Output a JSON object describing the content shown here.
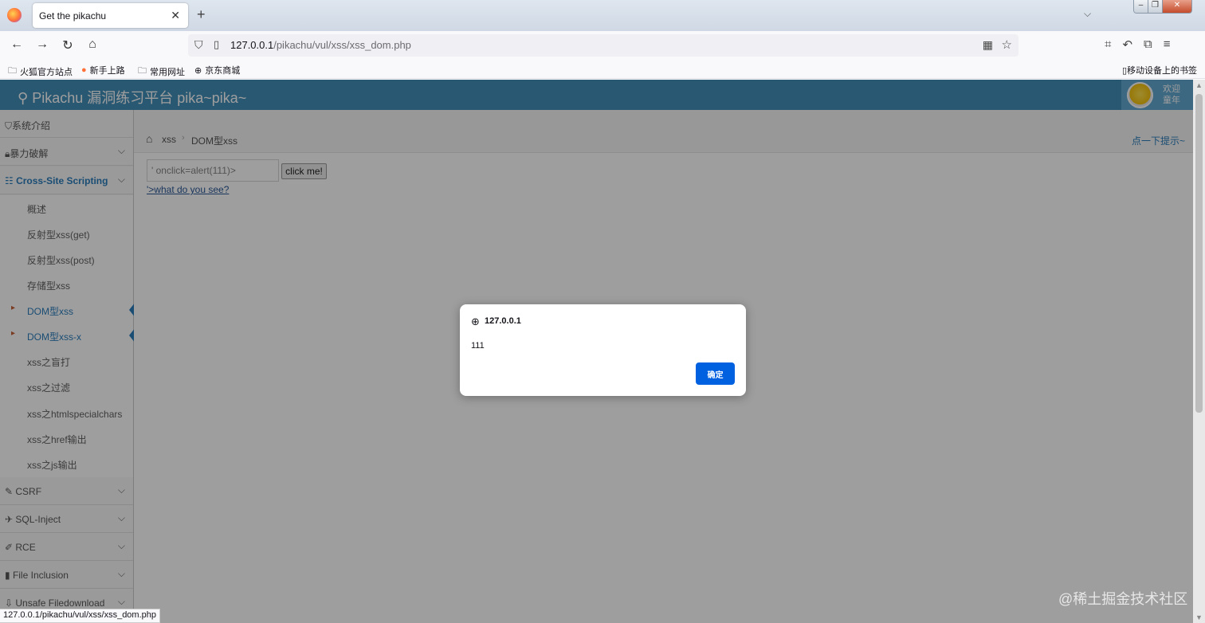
{
  "browser": {
    "tab_title": "Get the pikachu",
    "tab_close": "✕",
    "new_tab": "+",
    "tab_list": "⌵",
    "url_host": "127.0.0.1",
    "url_path": "/pikachu/vul/xss/xss_dom.php",
    "bookmarks": [
      "火狐官方站点",
      "新手上路",
      "常用网址",
      "京东商城"
    ],
    "mobile_bookmarks": "移动设备上的书签"
  },
  "site": {
    "title": "Pikachu 漏洞练习平台 pika~pika~",
    "welcome": "欢迎 童年"
  },
  "sidebar": {
    "items": [
      {
        "label": "系统介绍",
        "icon": "tag-icon"
      },
      {
        "label": "暴力破解",
        "icon": "lock-icon"
      },
      {
        "label": "Cross-Site Scripting",
        "icon": "list-icon"
      }
    ],
    "xss_sub": [
      "概述",
      "反射型xss(get)",
      "反射型xss(post)",
      "存储型xss",
      "DOM型xss",
      "DOM型xss-x",
      "xss之盲打",
      "xss之过滤",
      "xss之htmlspecialchars",
      "xss之href输出",
      "xss之js输出"
    ],
    "bottom_items": [
      {
        "label": "CSRF"
      },
      {
        "label": "SQL-Inject"
      },
      {
        "label": "RCE"
      },
      {
        "label": "File Inclusion"
      },
      {
        "label": "Unsafe Filedownload"
      }
    ]
  },
  "breadcrumb": {
    "level1": "xss",
    "level2": "DOM型xss",
    "hint": "点一下提示~"
  },
  "form": {
    "input_value": "' onclick=alert(111)>",
    "button_label": "click me!",
    "link_text": "'>what do you see?"
  },
  "dialog": {
    "origin": "127.0.0.1",
    "message": "111",
    "ok_label": "确定"
  },
  "status_bar": "127.0.0.1/pikachu/vul/xss/xss_dom.php",
  "watermark": "@稀土掘金技术社区"
}
